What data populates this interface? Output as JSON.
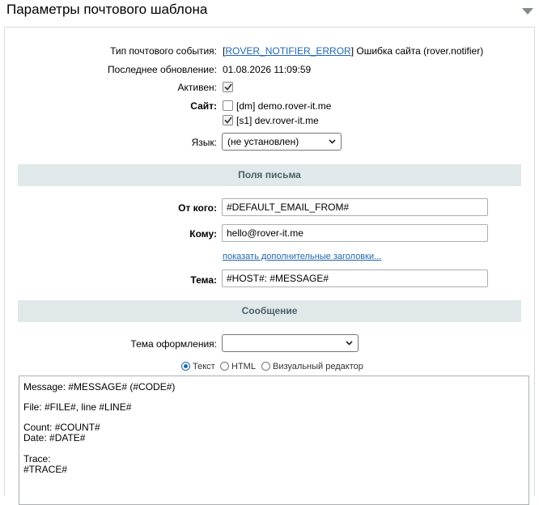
{
  "page": {
    "title": "Параметры почтового шаблона"
  },
  "fields": {
    "event_type": {
      "label": "Тип почтового события:",
      "bracket_open": "[",
      "link": "ROVER_NOTIFIER_ERROR",
      "rest": "] Ошибка сайта (rover.notifier)"
    },
    "last_update": {
      "label": "Последнее обновление:",
      "value": "01.08.2026 11:09:59"
    },
    "active": {
      "label": "Активен:",
      "checked": true
    },
    "site": {
      "label": "Сайт:",
      "options": [
        {
          "text": "[dm] demo.rover-it.me",
          "checked": false
        },
        {
          "text": "[s1] dev.rover-it.me",
          "checked": true
        }
      ]
    },
    "language": {
      "label": "Язык:",
      "value": "(не установлен)"
    }
  },
  "letter_fields": {
    "section_title": "Поля письма",
    "from": {
      "label": "От кого:",
      "value": "#DEFAULT_EMAIL_FROM#"
    },
    "to": {
      "label": "Кому:",
      "value": "hello@rover-it.me"
    },
    "more_headers_link": "показать дополнительные заголовки...",
    "subject": {
      "label": "Тема:",
      "value": "#HOST#: #MESSAGE#"
    }
  },
  "message": {
    "section_title": "Сообщение",
    "theme": {
      "label": "Тема оформления:",
      "value": ""
    },
    "modes": [
      {
        "label": "Текст",
        "selected": true
      },
      {
        "label": "HTML",
        "selected": false
      },
      {
        "label": "Визуальный редактор",
        "selected": false
      }
    ],
    "body_lines": [
      "Message: #MESSAGE# (#CODE#)",
      "",
      "File: #FILE#, line #LINE#",
      "",
      "Count: #COUNT#",
      "Date: #DATE#",
      "",
      "Trace:",
      "#TRACE#"
    ]
  },
  "colors": {
    "section_bg": "#e0e8ea",
    "section_text": "#4b6267",
    "link": "#2067b0",
    "panel_border": "#d7dcde"
  },
  "icons": {
    "collapse": "triangle-down-icon",
    "checkmark": "check-icon",
    "dropdown": "chevron-down-icon"
  }
}
